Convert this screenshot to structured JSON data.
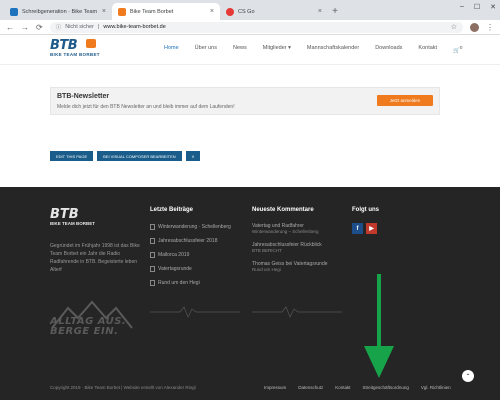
{
  "browser": {
    "tabs": [
      {
        "title": "Schreibgeneration · Bike Team B",
        "active": false,
        "favicon_color": "#1e73be"
      },
      {
        "title": "Bike Team Borbet",
        "active": true,
        "favicon_color": "#f07a1e"
      },
      {
        "title": "CS Go",
        "active": false,
        "favicon_color": "#e53935"
      }
    ],
    "new_tab_label": "+",
    "close_label": "×",
    "back_label": "←",
    "forward_label": "→",
    "reload_label": "⟳",
    "security_label": "Nicht sicher",
    "url": "www.bike-team-borbet.de",
    "window_controls": [
      "–",
      "☐",
      "✕"
    ]
  },
  "site": {
    "logo_text": "BTB",
    "logo_subtitle": "BIKE TEAM BORBET",
    "nav": [
      {
        "label": "Home",
        "active": true
      },
      {
        "label": "Über uns",
        "active": false
      },
      {
        "label": "News",
        "active": false
      },
      {
        "label": "Mitglieder ▾",
        "active": false
      },
      {
        "label": "Mannschaftskalender",
        "active": false
      },
      {
        "label": "Downloads",
        "active": false
      },
      {
        "label": "Kontakt",
        "active": false
      }
    ],
    "cart_label": "🛒",
    "cart_count": "0"
  },
  "newsletter": {
    "title": "BTB-Newsletter",
    "text": "Melde dich jetzt für den BTB Newsletter an und bleib immer auf dem Laufenden!",
    "button": "Jetzt anmelden"
  },
  "share_buttons": [
    "Edit this page",
    "Bei visual composer bearbeiten",
    "x"
  ],
  "footer": {
    "logo_text": "BTB",
    "logo_subtitle": "BIKE TEAM BORBET",
    "description": "Gegründet im Frühjahr 1998 ist das Bike Team Borbet ein Jahr die Radio Radfahrende in BTB. Begeisterte leben Alterf",
    "posts_title": "Letzte Beiträge",
    "posts": [
      "Winterwanderung · Schellenberg",
      "Jahresabschlussfeier 2018",
      "Mallorca 2019",
      "Vatertagsrunde",
      "Rund um den Hegi"
    ],
    "comments_title": "Neueste Kommentare",
    "comments": [
      {
        "who": "Vatertag und Radfahrer",
        "on": "Winterwanderung – Schellenberg"
      },
      {
        "who": "Jahresabschlussfeier Rückblick",
        "on": "BTB BERICHT"
      },
      {
        "who": "Thomas Geiss bei Vatertagsrunde",
        "on": "Rund um Hegi"
      }
    ],
    "social_title": "Folgt uns",
    "social": [
      {
        "name": "facebook",
        "glyph": "f"
      },
      {
        "name": "youtube",
        "glyph": "▶"
      }
    ],
    "motto_line1": "ALLTAG AUS.",
    "motto_line2": "BERGE EIN.",
    "copyright": "Copyright 2019 · Bike Team Borbet | Website erstellt von Alexander Ringl",
    "links": [
      "Impressum",
      "Datenschutz",
      "Kontakt",
      "Streitgeschäftsordnung",
      "Vgl. Richtlinien"
    ],
    "to_top": "⌃"
  },
  "colors": {
    "accent_blue": "#1e5a8a",
    "accent_orange": "#f07a1e",
    "footer_bg": "#252525",
    "arrow_green": "#17a34a"
  }
}
